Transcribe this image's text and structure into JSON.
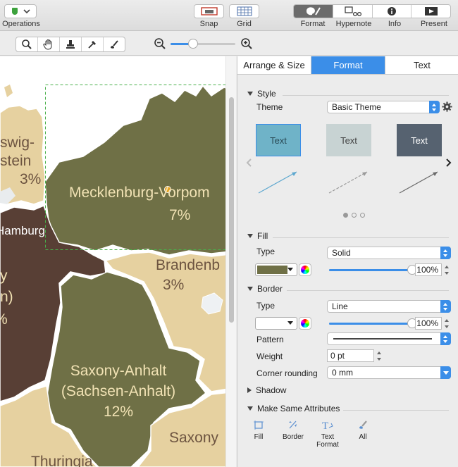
{
  "toolbar": {
    "operations_label": "Operations",
    "snap_label": "Snap",
    "grid_label": "Grid",
    "format_label": "Format",
    "hypernote_label": "Hypernote",
    "info_label": "Info",
    "present_label": "Present"
  },
  "zoom": {
    "value": 0.35
  },
  "canvas": {
    "regions": [
      {
        "name_line1": "swig-",
        "name_line2": "stein",
        "percent": "3%"
      },
      {
        "name_line1": "Mecklenburg-Vorpom",
        "percent": "7%"
      },
      {
        "name_line1": "Hamburg"
      },
      {
        "name_line1": "Brandenb",
        "percent": "3%"
      },
      {
        "name_line1": "y"
      },
      {
        "name_line1": "n)"
      },
      {
        "name_line1": "%"
      },
      {
        "name_line1": "Saxony-Anhalt",
        "name_line2": "(Sachsen-Anhalt)",
        "percent": "12%"
      },
      {
        "name_line1": "Saxony"
      },
      {
        "name_line1": "Thuringia"
      }
    ],
    "colors": {
      "olive": "#6f7046",
      "tan": "#e6d1a0",
      "brown": "#583f35",
      "label_light": "#f1e2b4",
      "label_dark": "#6d5440"
    }
  },
  "panel": {
    "tabs": [
      "Arrange & Size",
      "Format",
      "Text"
    ],
    "active_tab": "Format",
    "style": {
      "header": "Style",
      "theme_label": "Theme",
      "theme_value": "Basic Theme",
      "cards": [
        {
          "text": "Text",
          "bg": "#6fb3c8",
          "fg": "#2a4a55",
          "border": "#3b8ee8"
        },
        {
          "text": "Text",
          "bg": "#c8d3d3",
          "fg": "#444",
          "border": "#c8d3d3"
        },
        {
          "text": "Text",
          "bg": "#566270",
          "fg": "#ffffff",
          "border": "#566270"
        }
      ],
      "line_colors": [
        "#5ea8cf",
        "#9a9a9a",
        "#6a6a6a"
      ],
      "page_count": 3,
      "page_index": 0
    },
    "fill": {
      "header": "Fill",
      "type_label": "Type",
      "type_value": "Solid",
      "color": "#6f7046",
      "opacity": "100%",
      "opacity_value": 1.0
    },
    "border": {
      "header": "Border",
      "type_label": "Line",
      "type_field_label": "Type",
      "color": "#ffffff",
      "opacity": "100%",
      "opacity_value": 1.0,
      "pattern_label": "Pattern",
      "weight_label": "Weight",
      "weight_value": "0 pt",
      "corner_label": "Corner rounding",
      "corner_value": "0 mm"
    },
    "shadow": {
      "header": "Shadow"
    },
    "make_same": {
      "header": "Make Same Attributes",
      "items": [
        {
          "label_line1": "Fill",
          "label_line2": ""
        },
        {
          "label_line1": "Border",
          "label_line2": ""
        },
        {
          "label_line1": "Text",
          "label_line2": "Format"
        },
        {
          "label_line1": "All",
          "label_line2": ""
        }
      ]
    }
  }
}
